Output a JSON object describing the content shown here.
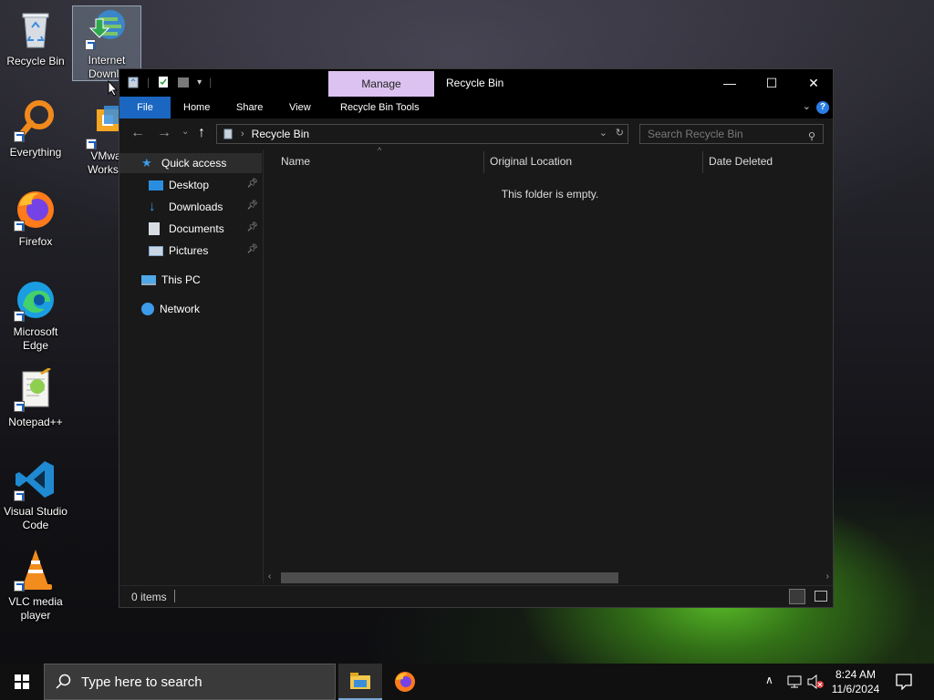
{
  "desktop": {
    "icons": [
      {
        "label": "Recycle Bin",
        "icon": "recycle-bin-icon"
      },
      {
        "label": "Internet Downlo",
        "icon": "idm-icon"
      },
      {
        "label": "Everything",
        "icon": "everything-search-icon"
      },
      {
        "label": "VMwar Worksta",
        "icon": "vmware-icon"
      },
      {
        "label": "Firefox",
        "icon": "firefox-icon"
      },
      {
        "label": "Microsoft Edge",
        "icon": "edge-icon"
      },
      {
        "label": "Notepad++",
        "icon": "notepadpp-icon"
      },
      {
        "label": "Visual Studio Code",
        "icon": "vscode-icon"
      },
      {
        "label": "VLC media player",
        "icon": "vlc-icon"
      }
    ]
  },
  "window": {
    "title": "Recycle Bin",
    "contextual_tab": "Manage",
    "controls": {
      "minimize": "—",
      "maximize": "☐",
      "close": "✕"
    },
    "ribbon_tabs": [
      "File",
      "Home",
      "Share",
      "View",
      "Recycle Bin Tools"
    ],
    "help": "?",
    "address": {
      "crumb": "Recycle Bin",
      "separator": "›"
    },
    "search_placeholder": "Search Recycle Bin",
    "nav_pane": [
      {
        "label": "Quick access",
        "icon": "star-icon",
        "pinned": false,
        "selected": true
      },
      {
        "label": "Desktop",
        "icon": "desktop-folder-icon",
        "pinned": true
      },
      {
        "label": "Downloads",
        "icon": "downloads-icon",
        "pinned": true
      },
      {
        "label": "Documents",
        "icon": "documents-icon",
        "pinned": true
      },
      {
        "label": "Pictures",
        "icon": "pictures-icon",
        "pinned": true
      },
      {
        "label": "This PC",
        "icon": "this-pc-icon",
        "pinned": false
      },
      {
        "label": "Network",
        "icon": "network-icon",
        "pinned": false
      }
    ],
    "columns": [
      "Name",
      "Original Location",
      "Date Deleted"
    ],
    "empty_message": "This folder is empty.",
    "status": "0 items"
  },
  "taskbar": {
    "search_placeholder": "Type here to search",
    "time": "8:24 AM",
    "date": "11/6/2024"
  },
  "colors": {
    "file_tab": "#1a66c0",
    "manage_tab": "#dcc2f0",
    "window_bg": "#191919"
  }
}
